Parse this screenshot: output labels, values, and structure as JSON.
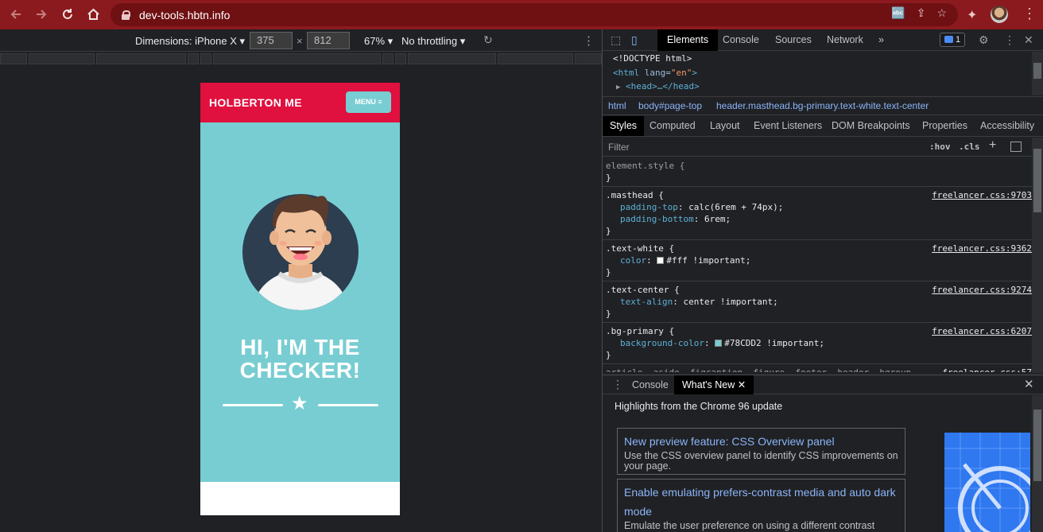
{
  "browser": {
    "back_icon": "arrow-left-icon",
    "forward_icon": "arrow-right-icon",
    "reload_icon": "reload-icon",
    "home_icon": "home-icon",
    "url": "dev-tools.hbtn.info",
    "accent_color": "#8b1a1e"
  },
  "device_toolbar": {
    "dimensions_label": "Dimensions: iPhone X",
    "width": "375",
    "height": "812",
    "zoom": "67%",
    "throttling": "No throttling"
  },
  "page": {
    "brand": "HOLBERTON ME",
    "menu_label": "MENU",
    "hero_title_line1": "HI, I'M THE",
    "hero_title_line2": "CHECKER!",
    "primary_color": "#e0103f",
    "bg_color": "#78CDD2"
  },
  "devtools": {
    "tabs": [
      "Elements",
      "Console",
      "Sources",
      "Network"
    ],
    "more_tabs": "»",
    "issues_count": "1",
    "dom": {
      "line1": "<!DOCTYPE html>",
      "line2_tag": "<html",
      "line2_attr": "lang=",
      "line2_val": "\"en\"",
      "line2_end": ">",
      "line3": "<head>…</head>"
    },
    "breadcrumbs": [
      "html",
      "body#page-top",
      "header.masthead.bg-primary.text-white.text-center"
    ],
    "subtabs": [
      "Styles",
      "Computed",
      "Layout",
      "Event Listeners",
      "DOM Breakpoints",
      "Properties",
      "Accessibility"
    ],
    "filter_placeholder": "Filter",
    "hov": ":hov",
    "cls": ".cls",
    "rules": [
      {
        "selector": "element.style {",
        "source": "",
        "decls": [],
        "close": "}"
      },
      {
        "selector": ".masthead {",
        "source": "freelancer.css:9703",
        "decls": [
          {
            "prop": "padding-top",
            "value": ": calc(6rem + 74px);"
          },
          {
            "prop": "padding-bottom",
            "value": ": 6rem;"
          }
        ],
        "close": "}"
      },
      {
        "selector": ".text-white {",
        "source": "freelancer.css:9362",
        "decls": [
          {
            "prop": "color",
            "swatch": "#ffffff",
            "value": "#fff !important;"
          }
        ],
        "close": "}"
      },
      {
        "selector": ".text-center {",
        "source": "freelancer.css:9274",
        "decls": [
          {
            "prop": "text-align",
            "value": ": center !important;"
          }
        ],
        "close": "}"
      },
      {
        "selector": ".bg-primary {",
        "source": "freelancer.css:6207",
        "decls": [
          {
            "prop": "background-color",
            "swatch": "#78CDD2",
            "value": "#78CDD2 !important;"
          }
        ],
        "close": "}"
      },
      {
        "selector": "article, aside, figcaption, figure, footer, header, hgroup,",
        "source": "freelancer.css:57",
        "decls": [],
        "close": ""
      }
    ],
    "drawer_tabs": [
      "Console",
      "What's New"
    ],
    "whats_new": {
      "heading": "Highlights from the Chrome 96 update",
      "items": [
        {
          "title": "New preview feature: CSS Overview panel",
          "desc": "Use the CSS overview panel to identify CSS improvements on your page."
        },
        {
          "title": "Enable emulating prefers-contrast media and auto dark mode",
          "desc": "Emulate the user preference on using a different contrast"
        }
      ]
    }
  }
}
